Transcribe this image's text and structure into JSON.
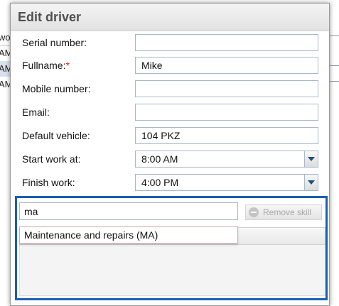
{
  "background": {
    "rows": [
      "wo",
      "AM",
      "AM",
      "AM"
    ]
  },
  "dialog": {
    "title": "Edit driver"
  },
  "form": {
    "serial_number": {
      "label": "Serial number:",
      "value": ""
    },
    "fullname": {
      "label": "Fullname:",
      "required_mark": "*",
      "value": "Mike"
    },
    "mobile_number": {
      "label": "Mobile number:",
      "value": ""
    },
    "email": {
      "label": "Email:",
      "value": ""
    },
    "default_vehicle": {
      "label": "Default vehicle:",
      "value": "104 PKZ"
    },
    "start_work": {
      "label": "Start work at:",
      "value": "8:00 AM"
    },
    "finish_work": {
      "label": "Finish work:",
      "value": "4:00 PM"
    }
  },
  "skills": {
    "search_value": "ma",
    "remove_label": "Remove skill",
    "suggestions": [
      "Maintenance and repairs (MA)"
    ]
  },
  "colors": {
    "highlight_border": "#1a5fb4",
    "required": "#d42020"
  },
  "icons": {
    "dropdown": "chevron-down-icon",
    "remove": "minus-circle-icon"
  }
}
